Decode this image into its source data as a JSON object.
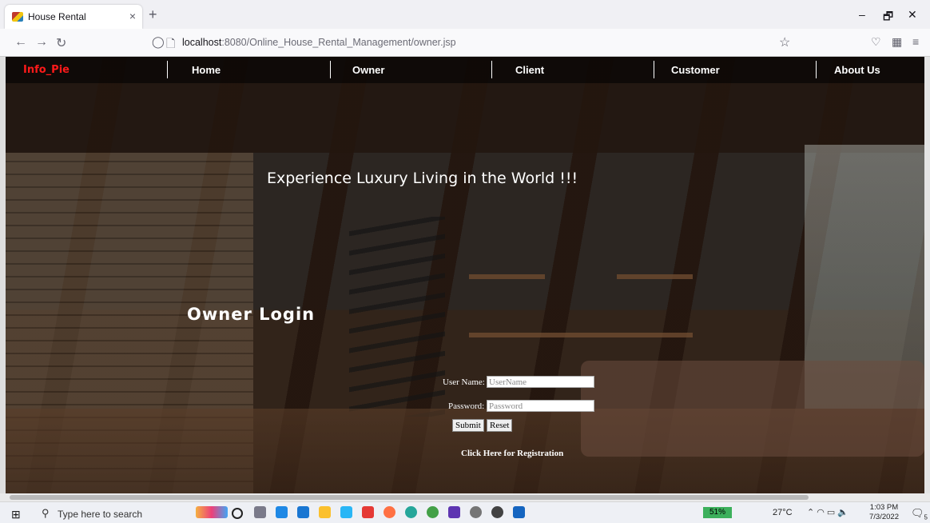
{
  "browser": {
    "tab_title": "House Rental",
    "tab_close": "×",
    "new_tab": "+",
    "url_host": "localhost",
    "url_rest": ":8080/Online_House_Rental_Management/owner.jsp",
    "minimize": "–",
    "restore": "🗗",
    "close": "✕",
    "back": "←",
    "forward": "→",
    "reload": "↻"
  },
  "site": {
    "brand": "Info_Pie",
    "menu": [
      "Home",
      "Owner",
      "Client",
      "Customer",
      "About Us"
    ],
    "headline": "Experience Luxury Living in the World !!!",
    "login_title": "Owner Login",
    "form": {
      "username_label": "User Name:",
      "username_placeholder": "UserName",
      "password_label": "Password:",
      "password_placeholder": "Password",
      "submit_label": "Submit",
      "reset_label": "Reset",
      "registration_link": "Click Here for Registration"
    }
  },
  "taskbar": {
    "search_placeholder": "Type here to search",
    "battery": "51%",
    "temperature": "27°C",
    "time": "1:03 PM",
    "date": "7/3/2022",
    "notifications": "5"
  },
  "colors": {
    "brand": "#ff1a1a",
    "page_overlay": "#0f0a08"
  }
}
